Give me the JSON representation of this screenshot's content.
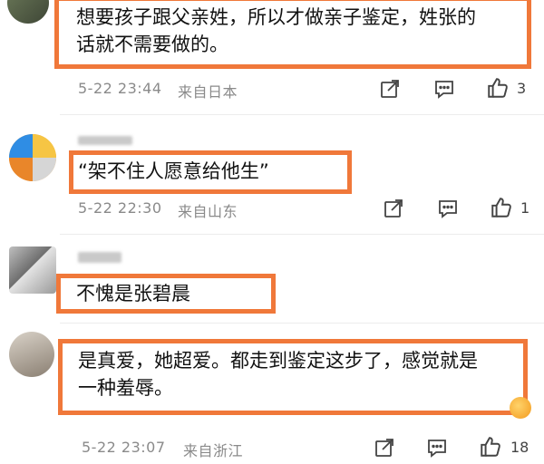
{
  "comments": [
    {
      "text": "想要孩子跟父亲姓，所以才做亲子鉴定，姓张的\n话就不需要做的。",
      "time": "5-22 23:44",
      "source": "来自日本",
      "likes": "3"
    },
    {
      "text": "“架不住人愿意给他生”",
      "time": "5-22 22:30",
      "source": "来自山东",
      "likes": "1"
    },
    {
      "text": "不愧是张碧晨",
      "time": "",
      "source": "",
      "likes": ""
    },
    {
      "text": "是真爱，她超爱。都走到鉴定这步了，感觉就是\n一种羞辱。",
      "time": "5-22 23:07",
      "source": "来自浙江",
      "likes": "18"
    }
  ],
  "icons": [
    "share-icon",
    "comment-icon",
    "like-icon"
  ],
  "colors": {
    "highlight": "#f0783a",
    "meta": "#8a8a8a",
    "text": "#111111"
  }
}
